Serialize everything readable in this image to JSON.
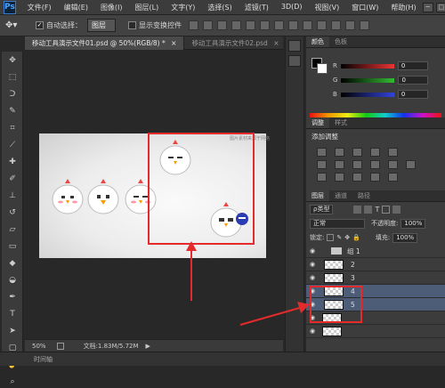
{
  "app": {
    "logo": "Ps"
  },
  "menu": [
    "文件(F)",
    "编辑(E)",
    "图像(I)",
    "图层(L)",
    "文字(Y)",
    "选择(S)",
    "滤镜(T)",
    "3D(D)",
    "视图(V)",
    "窗口(W)",
    "帮助(H)"
  ],
  "window_controls": [
    "─",
    "□",
    "✕"
  ],
  "options": {
    "tool_icon": "move-tool-icon",
    "auto_select_label": "自动选择：",
    "auto_select_checked": true,
    "auto_select_target": "图层",
    "show_transform_label": "显示变换控件",
    "show_transform_checked": false
  },
  "tabs": [
    {
      "label": "移动工具演示文件01.psd @ 50%(RGB/8) *",
      "close": "×",
      "active": true
    },
    {
      "label": "移动工具演示文件02.psd",
      "close": "×",
      "active": false
    }
  ],
  "doc_caption": "图片素材来源于网络",
  "status": {
    "zoom": "50%",
    "doc_info": "文档:1.83M/5.72M"
  },
  "timeline_label": "时间轴",
  "color_panel": {
    "tabs": [
      "颜色",
      "色板"
    ],
    "channels": [
      {
        "label": "R",
        "value": "0",
        "color": "#e33"
      },
      {
        "label": "G",
        "value": "0",
        "color": "#3b3"
      },
      {
        "label": "B",
        "value": "0",
        "color": "#34d"
      }
    ]
  },
  "adjust_panel": {
    "tabs": [
      "调整",
      "样式"
    ],
    "title": "添加调整"
  },
  "layers_panel": {
    "tabs": [
      "图层",
      "通道",
      "路径"
    ],
    "filter_label": "ρ类型",
    "blend_mode": "正常",
    "opacity_label": "不透明度:",
    "opacity_value": "100%",
    "lock_label": "锁定:",
    "fill_label": "填充:",
    "fill_value": "100%",
    "layers": [
      {
        "name": "组 1",
        "kind": "group",
        "selected": false
      },
      {
        "name": "2",
        "kind": "layer",
        "selected": false
      },
      {
        "name": "3",
        "kind": "layer",
        "selected": false
      },
      {
        "name": "4",
        "kind": "layer",
        "selected": true
      },
      {
        "name": "5",
        "kind": "layer",
        "selected": true
      },
      {
        "name": "",
        "kind": "layer",
        "selected": false
      },
      {
        "name": "",
        "kind": "layer",
        "selected": false
      }
    ]
  }
}
